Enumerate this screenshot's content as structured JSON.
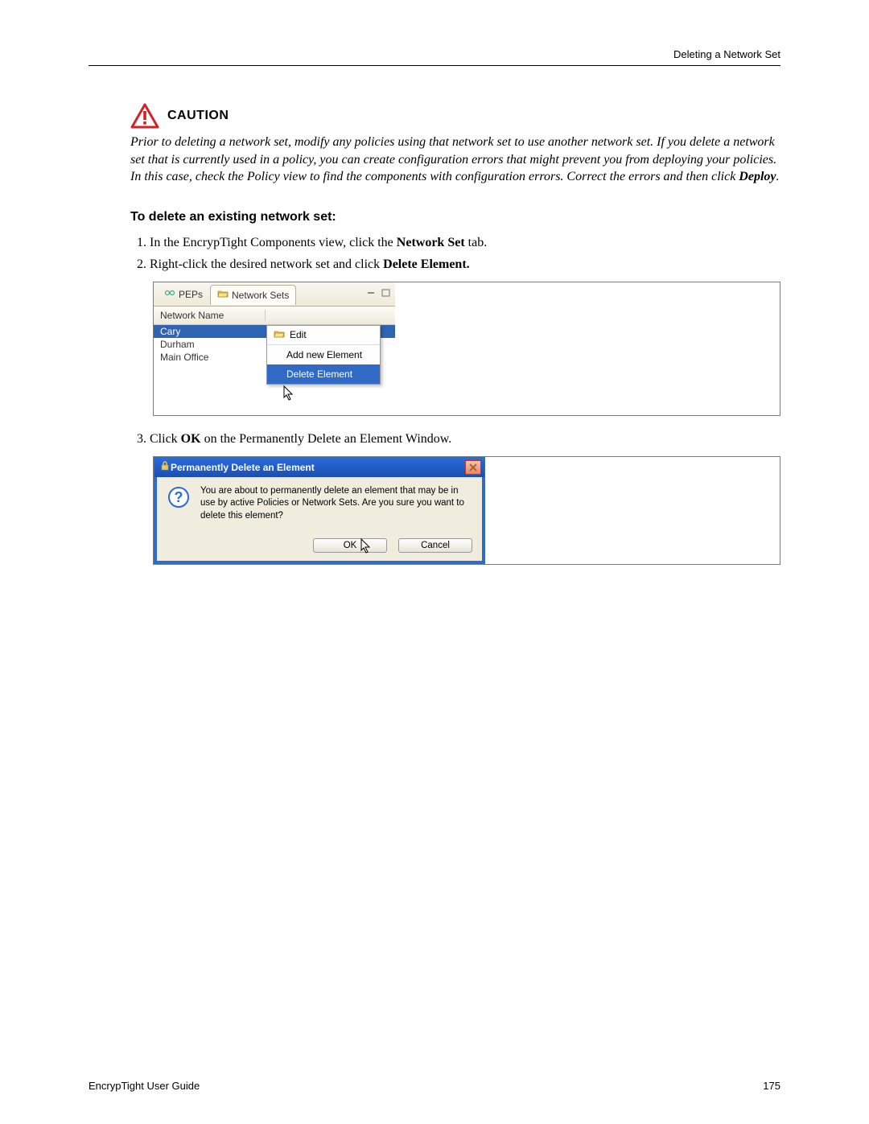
{
  "header": {
    "breadcrumb": "Deleting a Network Set"
  },
  "caution": {
    "flag": "CAUTION",
    "body_pre": "Prior to deleting a network set, modify any policies using that network set to use another network set. If you delete a network set that is currently used in a policy, you can create configuration errors that might prevent you from deploying your policies. In this case, check the Policy view to find the components with configuration errors. Correct the errors and then click ",
    "body_bold": "Deploy",
    "body_post": "."
  },
  "section": {
    "heading": "To delete an existing network set:"
  },
  "steps": {
    "s1_pre": "In the EncrypTight Components view, click the ",
    "s1_b": "Network Set",
    "s1_post": " tab.",
    "s2_pre": "Right-click the desired network set and click ",
    "s2_b": "Delete Element.",
    "s3_pre": "Click ",
    "s3_b": "OK",
    "s3_post": " on the Permanently Delete an Element Window."
  },
  "panel": {
    "tab_peps": "PEPs",
    "tab_nsets": "Network Sets",
    "col": "Network Name",
    "rows": [
      "Cary",
      "Durham",
      "Main Office"
    ],
    "menu_title": "Edit",
    "menu_add": "Add new Element",
    "menu_del": "Delete Element"
  },
  "dialog": {
    "title": "Permanently Delete an Element",
    "msg": "You are about to permanently delete an element that may be in use by active Policies or Network Sets. Are you sure you want to delete this element?",
    "ok": "OK",
    "cancel": "Cancel"
  },
  "footer": {
    "left": "EncrypTight User Guide",
    "right": "175"
  }
}
